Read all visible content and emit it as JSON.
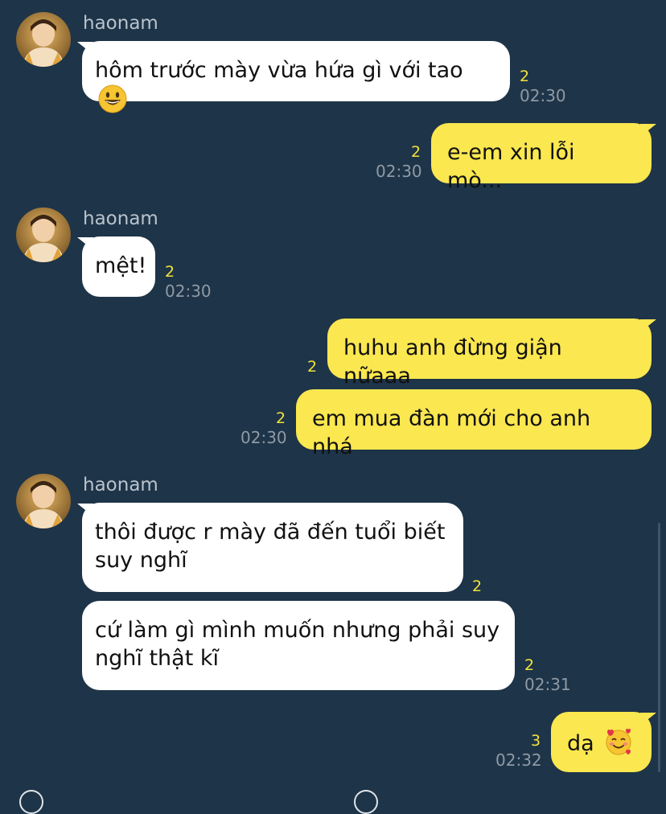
{
  "chat": {
    "messages": [
      {
        "sender": "haonam",
        "text": "hôm trước mày vừa hứa gì với tao",
        "emoji": "grinning-face",
        "unread": "2",
        "time": "02:30"
      },
      {
        "sender": "me",
        "text": "e-em xin lỗi mò...",
        "unread": "2",
        "time": "02:30"
      },
      {
        "sender": "haonam",
        "text": "mệt!",
        "unread": "2",
        "time": "02:30"
      },
      {
        "sender": "me",
        "text": "huhu anh đừng giận nữaaa",
        "unread": "2"
      },
      {
        "sender": "me",
        "text": "em mua đàn mới cho anh nhá",
        "unread": "2",
        "time": "02:30"
      },
      {
        "sender": "haonam",
        "text_lines": [
          "thôi được r mày đã đến tuổi biết",
          "suy nghĩ"
        ],
        "unread": "2"
      },
      {
        "sender": "haonam",
        "text_lines": [
          "cứ làm gì mình muốn nhưng phải suy",
          "nghĩ thật kĩ"
        ],
        "unread": "2",
        "time": "02:31"
      },
      {
        "sender": "me",
        "text": "dạ",
        "emoji": "smiling-face-with-hearts",
        "unread": "3",
        "time": "02:32"
      }
    ]
  },
  "colors": {
    "background": "#1e3448",
    "incoming_bubble": "#ffffff",
    "outgoing_bubble": "#fbe74f",
    "unread_count": "#f2e23e",
    "timestamp": "#8e9aa5"
  }
}
